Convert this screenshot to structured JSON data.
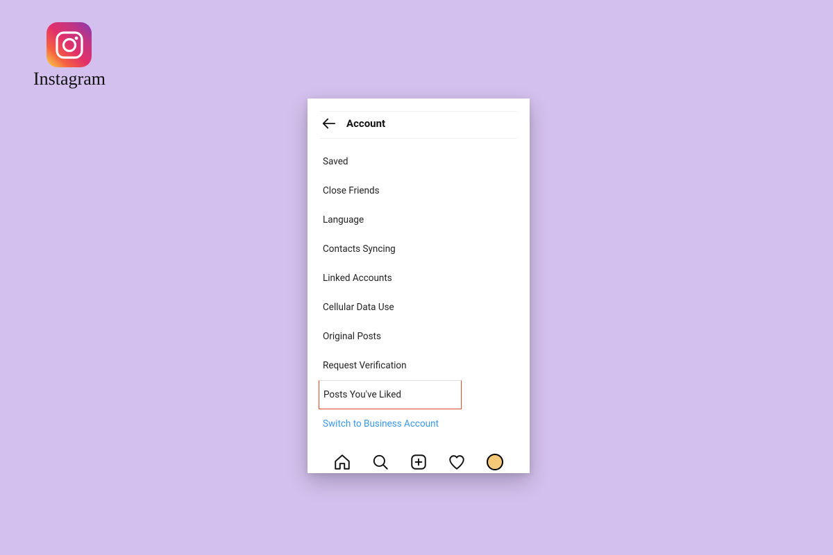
{
  "brand": {
    "wordmark": "Instagram"
  },
  "header": {
    "title": "Account"
  },
  "menu": {
    "items": [
      {
        "label": "Saved",
        "highlight": false,
        "link": false
      },
      {
        "label": "Close Friends",
        "highlight": false,
        "link": false
      },
      {
        "label": "Language",
        "highlight": false,
        "link": false
      },
      {
        "label": "Contacts Syncing",
        "highlight": false,
        "link": false
      },
      {
        "label": "Linked Accounts",
        "highlight": false,
        "link": false
      },
      {
        "label": "Cellular Data Use",
        "highlight": false,
        "link": false
      },
      {
        "label": "Original Posts",
        "highlight": false,
        "link": false
      },
      {
        "label": "Request Verification",
        "highlight": false,
        "link": false
      },
      {
        "label": "Posts You've Liked",
        "highlight": true,
        "link": false
      },
      {
        "label": "Switch to Business Account",
        "highlight": false,
        "link": true
      }
    ]
  },
  "nav": {
    "home": "home-icon",
    "search": "search-icon",
    "add": "add-icon",
    "activity": "heart-icon",
    "profile": "profile-icon"
  }
}
